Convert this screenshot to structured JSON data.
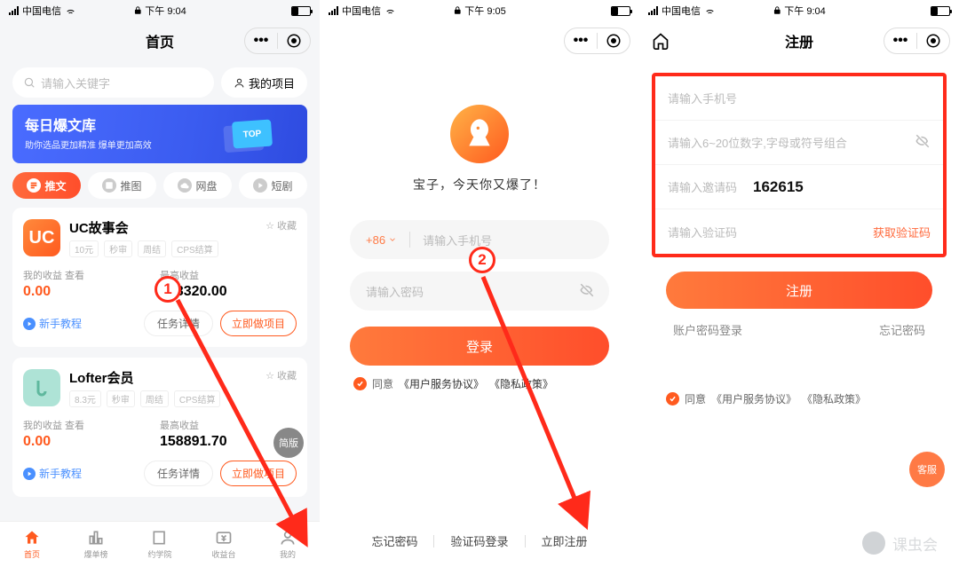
{
  "status": {
    "carrier": "中国电信",
    "t1": "下午 9:04",
    "t2": "下午 9:05",
    "t3": "下午 9:04"
  },
  "s1": {
    "title": "首页",
    "search_ph": "请输入关键字",
    "my_proj": "我的项目",
    "banner_title": "每日爆文库",
    "banner_sub": "助你选品更加精准 爆单更加高效",
    "banner_chip": "TOP",
    "pills": [
      "推文",
      "推图",
      "网盘",
      "短剧"
    ],
    "card1": {
      "name": "UC故事会",
      "fav": "收藏",
      "tags": [
        "10元",
        "秒审",
        "周结",
        "CPS结算"
      ],
      "my_label": "我的收益 查看",
      "my_val": "0.00",
      "max_label": "最高收益",
      "max_val": "278320.00",
      "newbie": "新手教程",
      "detail": "任务详情",
      "do": "立即做项目"
    },
    "card2": {
      "name": "Lofter会员",
      "fav": "收藏",
      "tags": [
        "8.3元",
        "秒审",
        "周结",
        "CPS结算"
      ],
      "my_label": "我的收益 查看",
      "my_val": "0.00",
      "max_label": "最高收益",
      "max_val": "158891.70",
      "newbie": "新手教程",
      "detail": "任务详情",
      "do": "立即做项目",
      "simple": "简版"
    },
    "nav": [
      "首页",
      "爆单榜",
      "约学院",
      "收益台",
      "我的"
    ]
  },
  "s2": {
    "slogan": "宝子，今天你又爆了！",
    "cc": "+86",
    "phone_ph": "请输入手机号",
    "pwd_ph": "请输入密码",
    "login": "登录",
    "agree": "同意",
    "tos": "《用户服务协议》",
    "pp": "《隐私政策》",
    "links": [
      "忘记密码",
      "验证码登录",
      "立即注册"
    ]
  },
  "s3": {
    "title": "注册",
    "phone_ph": "请输入手机号",
    "pwd_ph": "请输入6~20位数字,字母或符号组合",
    "invite_ph": "请输入邀请码",
    "invite_val": "162615",
    "code_ph": "请输入验证码",
    "getcode": "获取验证码",
    "btn": "注册",
    "login_pwd": "账户密码登录",
    "forgot": "忘记密码",
    "agree": "同意",
    "tos": "《用户服务协议》",
    "pp": "《隐私政策》",
    "kefu": "客服"
  },
  "anno": {
    "n1": "1",
    "n2": "2"
  },
  "watermark": "课虫会"
}
